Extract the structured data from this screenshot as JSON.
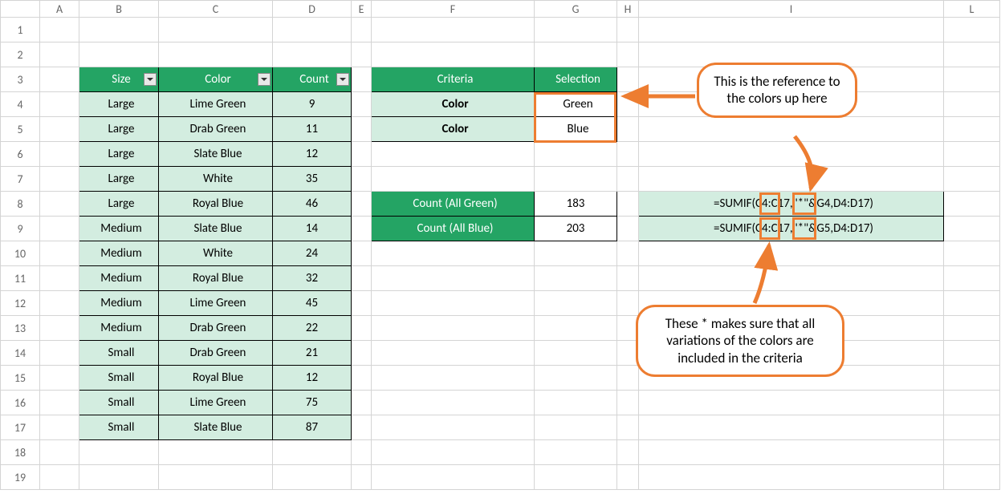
{
  "columns": [
    "A",
    "B",
    "C",
    "D",
    "E",
    "F",
    "G",
    "H",
    "I",
    "L"
  ],
  "rowNumbers": [
    "1",
    "2",
    "3",
    "4",
    "5",
    "6",
    "7",
    "8",
    "9",
    "10",
    "11",
    "12",
    "13",
    "14",
    "15",
    "16",
    "17",
    "18",
    "19"
  ],
  "dataTable": {
    "headers": {
      "size": "Size",
      "color": "Color",
      "count": "Count"
    },
    "rows": [
      {
        "size": "Large",
        "color": "Lime Green",
        "count": "9"
      },
      {
        "size": "Large",
        "color": "Drab Green",
        "count": "11"
      },
      {
        "size": "Large",
        "color": "Slate Blue",
        "count": "12"
      },
      {
        "size": "Large",
        "color": "White",
        "count": "35"
      },
      {
        "size": "Large",
        "color": "Royal Blue",
        "count": "46"
      },
      {
        "size": "Medium",
        "color": "Slate Blue",
        "count": "14"
      },
      {
        "size": "Medium",
        "color": "White",
        "count": "24"
      },
      {
        "size": "Medium",
        "color": "Royal Blue",
        "count": "32"
      },
      {
        "size": "Medium",
        "color": "Lime Green",
        "count": "45"
      },
      {
        "size": "Medium",
        "color": "Drab Green",
        "count": "22"
      },
      {
        "size": "Small",
        "color": "Drab Green",
        "count": "21"
      },
      {
        "size": "Small",
        "color": "Royal Blue",
        "count": "12"
      },
      {
        "size": "Small",
        "color": "Lime Green",
        "count": "75"
      },
      {
        "size": "Small",
        "color": "Slate Blue",
        "count": "87"
      }
    ]
  },
  "criteria": {
    "headers": {
      "criteria": "Criteria",
      "selection": "Selection"
    },
    "rows": [
      {
        "criteria": "Color",
        "selection": "Green"
      },
      {
        "criteria": "Color",
        "selection": "Blue"
      }
    ]
  },
  "results": {
    "rows": [
      {
        "label": "Count (All Green)",
        "value": "183",
        "formula": "=SUMIF(C4:C17,\"*\"&G4,D4:D17)"
      },
      {
        "label": "Count (All Blue)",
        "value": "203",
        "formula": "=SUMIF(C4:C17,\"*\"&G5,D4:D17)"
      }
    ]
  },
  "callouts": {
    "top": "This is the reference to the colors up here",
    "bottom": "These * makes sure that all variations of the colors are included in the criteria"
  }
}
